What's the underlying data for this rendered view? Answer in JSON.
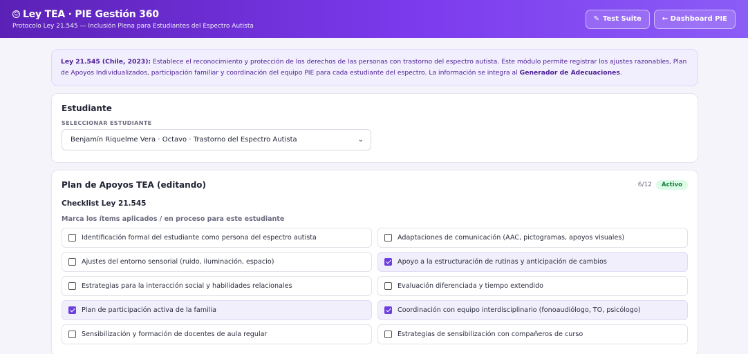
{
  "header": {
    "title": "Ley TEA · PIE Gestión 360",
    "subtitle": "Protocolo Ley 21.545 — Inclusión Plena para Estudiantes del Espectro Autista",
    "test_suite_label": "Test Suite",
    "dashboard_label": "← Dashboard PIE"
  },
  "notice": {
    "law": "Ley 21.545 (Chile, 2023):",
    "text": " Establece el reconocimiento y protección de los derechos de las personas con trastorno del espectro autista. Este módulo permite registrar los ajustes razonables, Plan de Apoyos Individualizados, participación familiar y coordinación del equipo PIE para cada estudiante del espectro. La información se integra al ",
    "link": "Generador de Adecuaciones",
    "end": "."
  },
  "student": {
    "title": "Estudiante",
    "select_label": "SELECCIONAR ESTUDIANTE",
    "selected": "Benjamín Riquelme Vera · Octavo · Trastorno del Espectro Autista"
  },
  "plan": {
    "title": "Plan de Apoyos TEA (editando)",
    "progress": "6/12",
    "status": "Activo",
    "checklist_title": "Checklist Ley 21.545",
    "hint": "Marca los ítems aplicados / en proceso para este estudiante",
    "items": [
      {
        "label": "Identificación formal del estudiante como persona del espectro autista",
        "checked": false
      },
      {
        "label": "Adaptaciones de comunicación (AAC, pictogramas, apoyos visuales)",
        "checked": false
      },
      {
        "label": "Ajustes del entorno sensorial (ruido, iluminación, espacio)",
        "checked": false
      },
      {
        "label": "Apoyo a la estructuración de rutinas y anticipación de cambios",
        "checked": true
      },
      {
        "label": "Estrategias para la interacción social y habilidades relacionales",
        "checked": false
      },
      {
        "label": "Evaluación diferenciada y tiempo extendido",
        "checked": false
      },
      {
        "label": "Plan de participación activa de la familia",
        "checked": true
      },
      {
        "label": "Coordinación con equipo interdisciplinario (fonoaudiólogo, TO, psicólogo)",
        "checked": true
      },
      {
        "label": "Sensibilización y formación de docentes de aula regular",
        "checked": false
      },
      {
        "label": "Estrategias de sensibilización con compañeros de curso",
        "checked": false
      }
    ]
  }
}
